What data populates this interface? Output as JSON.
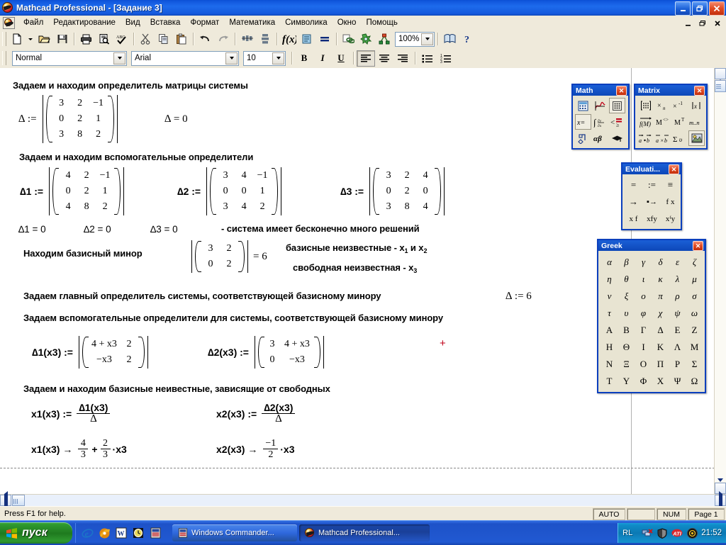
{
  "window": {
    "title": "Mathcad Professional - [Задание  3]",
    "app_icon": "mathcad-logo-icon",
    "buttons": {
      "minimize": "–",
      "restore": "❐",
      "close": "✕"
    }
  },
  "menu": {
    "items": [
      {
        "label": "Файл",
        "name": "menu-file"
      },
      {
        "label": "Редактирование",
        "name": "menu-edit"
      },
      {
        "label": "Вид",
        "name": "menu-view"
      },
      {
        "label": "Вставка",
        "name": "menu-insert"
      },
      {
        "label": "Формат",
        "name": "menu-format"
      },
      {
        "label": "Математика",
        "name": "menu-math"
      },
      {
        "label": "Символика",
        "name": "menu-symbolics"
      },
      {
        "label": "Окно",
        "name": "menu-window"
      },
      {
        "label": "Помощь",
        "name": "menu-help"
      }
    ],
    "mdi_buttons": {
      "minimize": "–",
      "restore": "❐",
      "close": "✕"
    }
  },
  "standard_toolbar": {
    "buttons": [
      {
        "name": "new-document-icon",
        "tip": "New"
      },
      {
        "name": "new-dropdown-icon",
        "tip": "New dropdown"
      },
      {
        "name": "open-folder-icon",
        "tip": "Open"
      },
      {
        "name": "save-icon",
        "tip": "Save"
      },
      {
        "name": "print-icon",
        "tip": "Print"
      },
      {
        "name": "print-preview-icon",
        "tip": "Print Preview"
      },
      {
        "name": "spellcheck-icon",
        "tip": "Check Spelling"
      },
      {
        "name": "cut-scissors-icon",
        "tip": "Cut"
      },
      {
        "name": "copy-icon",
        "tip": "Copy"
      },
      {
        "name": "paste-icon",
        "tip": "Paste"
      },
      {
        "name": "undo-icon",
        "tip": "Undo"
      },
      {
        "name": "redo-icon",
        "tip": "Redo"
      },
      {
        "name": "align-across-icon",
        "tip": "Align Across"
      },
      {
        "name": "align-down-icon",
        "tip": "Align Down"
      },
      {
        "name": "insert-function-icon",
        "tip": "Insert Function"
      },
      {
        "name": "insert-unit-icon",
        "tip": "Insert Unit"
      },
      {
        "name": "calculate-icon",
        "tip": "Calculate"
      },
      {
        "name": "insert-hyperlink-icon",
        "tip": "Insert Hyperlink"
      },
      {
        "name": "component-wizard-icon",
        "tip": "Component Wizard"
      },
      {
        "name": "resource-center-icon",
        "tip": "Resource Center"
      },
      {
        "name": "help-book-icon",
        "tip": "Help Topics"
      },
      {
        "name": "help-question-icon",
        "tip": "Context Help"
      }
    ],
    "zoom": {
      "value": "100%",
      "name": "zoom-combo"
    }
  },
  "format_toolbar": {
    "style": {
      "value": "Normal",
      "name": "paragraph-style-combo"
    },
    "font": {
      "value": "Arial",
      "name": "font-name-combo"
    },
    "size": {
      "value": "10",
      "name": "font-size-combo"
    },
    "bold": "B",
    "italic": "I",
    "underline": "U",
    "align_left": "align-left-icon",
    "align_center": "align-center-icon",
    "align_right": "align-right-icon",
    "bullet_list": "bullet-list-icon",
    "number_list": "numbered-list-icon"
  },
  "document": {
    "regions": [
      {
        "id": "h1",
        "kind": "text",
        "text": "Задаем и находим определитель матрицы системы"
      },
      {
        "id": "d1",
        "kind": "matrix-def",
        "label": "∆ :=",
        "matrix": [
          [
            "3",
            "2",
            "−1"
          ],
          [
            "0",
            "2",
            "1"
          ],
          [
            "3",
            "8",
            "2"
          ]
        ]
      },
      {
        "id": "d1res",
        "kind": "eval",
        "text": "∆ = 0"
      },
      {
        "id": "h2",
        "kind": "text",
        "text": "Задаем и находим вспомогательные определители"
      },
      {
        "id": "d2",
        "kind": "matrix-def",
        "label": "∆1 :=",
        "matrix": [
          [
            "4",
            "2",
            "−1"
          ],
          [
            "0",
            "2",
            "1"
          ],
          [
            "4",
            "8",
            "2"
          ]
        ]
      },
      {
        "id": "d3",
        "kind": "matrix-def",
        "label": "∆2 :=",
        "matrix": [
          [
            "3",
            "4",
            "−1"
          ],
          [
            "0",
            "0",
            "1"
          ],
          [
            "3",
            "4",
            "2"
          ]
        ]
      },
      {
        "id": "d4",
        "kind": "matrix-def",
        "label": "∆3 :=",
        "matrix": [
          [
            "3",
            "2",
            "4"
          ],
          [
            "0",
            "2",
            "0"
          ],
          [
            "3",
            "8",
            "4"
          ]
        ]
      },
      {
        "id": "r1",
        "kind": "eval",
        "text": "∆1 = 0"
      },
      {
        "id": "r2",
        "kind": "eval",
        "text": "∆2 = 0"
      },
      {
        "id": "r3",
        "kind": "eval",
        "text": "∆3 = 0"
      },
      {
        "id": "note1",
        "kind": "text",
        "text": "- система имеет бесконечно много решений"
      },
      {
        "id": "h3",
        "kind": "text",
        "text": "Находим базисный минор"
      },
      {
        "id": "minor",
        "kind": "matrix-eval",
        "matrix": [
          [
            "3",
            "2"
          ],
          [
            "0",
            "2"
          ]
        ],
        "result": "= 6"
      },
      {
        "id": "note2",
        "kind": "text",
        "text": "базисные неизвестные - x1 и x2"
      },
      {
        "id": "note3",
        "kind": "text",
        "text": "свободная неизвестная - x3"
      },
      {
        "id": "h4",
        "kind": "text",
        "text": "Задаем главный определитель системы, соответствующей базисному минору"
      },
      {
        "id": "delta6",
        "kind": "eval",
        "text": "∆ := 6"
      },
      {
        "id": "h5",
        "kind": "text",
        "text": "Задаем вспомогательные определители для системы, соответствующей базисному минору"
      },
      {
        "id": "dx1",
        "kind": "matrix-def",
        "label": "∆1(x3) :=",
        "matrix": [
          [
            "4 + x3",
            "2"
          ],
          [
            "−x3",
            "2"
          ]
        ]
      },
      {
        "id": "dx2",
        "kind": "matrix-def",
        "label": "∆2(x3) :=",
        "matrix": [
          [
            "3",
            "4 + x3"
          ],
          [
            "0",
            "−x3"
          ]
        ]
      },
      {
        "id": "h6",
        "kind": "text",
        "text": "Задаем и находим базисные неивестные, зависящие от свободных"
      },
      {
        "id": "x1def",
        "kind": "fraction-def",
        "label": "x1(x3) :=",
        "num": "∆1(x3)",
        "den": "∆"
      },
      {
        "id": "x2def",
        "kind": "fraction-def",
        "label": "x2(x3) :=",
        "num": "∆2(x3)",
        "den": "∆"
      },
      {
        "id": "x1res",
        "kind": "symbolic",
        "label": "x1(x3) →",
        "terms": [
          {
            "num": "4",
            "den": "3"
          },
          {
            "op": "+"
          },
          {
            "num": "2",
            "den": "3",
            "mul": "·x3"
          }
        ]
      },
      {
        "id": "x2res",
        "kind": "symbolic",
        "label": "x2(x3) →",
        "terms": [
          {
            "num": "−1",
            "den": "2",
            "mul": "·x3"
          }
        ]
      }
    ],
    "labels": {
      "h1": "Задаем и находим определитель матрицы системы",
      "h2": "Задаем и находим вспомогательные определители",
      "h3": "Находим базисный минор",
      "h4": "Задаем главный определитель системы, соответствующей базисному минору",
      "h5": "Задаем вспомогательные определители для системы, соответствующей базисному минору",
      "h6": "Задаем и находим базисные неивестные, зависящие от свободных",
      "note1": "- система имеет бесконечно много решений",
      "note2_pre": "базисные неизвестные - x",
      "note2_a": "1",
      "note2_mid": " и x",
      "note2_b": "2",
      "note3_pre": "свободная неизвестная - x",
      "note3_a": "3",
      "d1_label": "∆ :=",
      "d1_result": "∆ = 0",
      "d2_label": "∆1 :=",
      "d3_label": "∆2 :=",
      "d4_label": "∆3 :=",
      "r1": "∆1 = 0",
      "r2": "∆2 = 0",
      "r3": "∆3 = 0",
      "minor_result": "= 6",
      "delta6": "∆ := 6",
      "dx1_label": "∆1(x3) :=",
      "dx2_label": "∆2(x3) :=",
      "x1_label": "x1(x3) :=",
      "x2_label": "x2(x3) :=",
      "x1_num": "∆1(x3)",
      "x2_num": "∆2(x3)",
      "den_delta": "∆",
      "x1_arrow": "x1(x3) →",
      "x2_arrow": "x2(x3) →",
      "f43_n": "4",
      "f43_d": "3",
      "plus": "+",
      "f23_n": "2",
      "f23_d": "3",
      "f23_mul": "·x3",
      "fm12_n": "−1",
      "fm12_d": "2",
      "fm12_mul": "·x3"
    },
    "cursor": "+"
  },
  "palettes": {
    "math": {
      "title": "Math",
      "close": "✕",
      "buttons": [
        {
          "name": "calculator-palette-icon",
          "glyph": "calc"
        },
        {
          "name": "graph-palette-icon",
          "glyph": "graph"
        },
        {
          "name": "matrix-palette-icon",
          "glyph": "matrix"
        },
        {
          "name": "evaluation-palette-icon",
          "glyph": "x="
        },
        {
          "name": "calculus-palette-icon",
          "glyph": "∫"
        },
        {
          "name": "boolean-palette-icon",
          "glyph": "<"
        },
        {
          "name": "programming-palette-icon",
          "glyph": "prog"
        },
        {
          "name": "greek-palette-icon",
          "glyph": "αβ"
        },
        {
          "name": "symbolic-palette-icon",
          "glyph": "cap"
        }
      ]
    },
    "matrix": {
      "title": "Matrix",
      "close": "✕",
      "buttons": [
        {
          "name": "insert-matrix-icon",
          "glyph": "[:::]"
        },
        {
          "name": "matrix-subscript-icon",
          "glyph": "×n"
        },
        {
          "name": "matrix-inverse-icon",
          "glyph": "x⁻¹"
        },
        {
          "name": "determinant-icon",
          "glyph": "|x|"
        },
        {
          "name": "vectorize-icon",
          "glyph": "f(M)"
        },
        {
          "name": "matrix-column-icon",
          "glyph": "M<>"
        },
        {
          "name": "matrix-transpose-icon",
          "glyph": "Mᵀ"
        },
        {
          "name": "range-variable-icon",
          "glyph": "m..n"
        },
        {
          "name": "dot-product-icon",
          "glyph": "a·b"
        },
        {
          "name": "cross-product-icon",
          "glyph": "a×b"
        },
        {
          "name": "vector-sum-icon",
          "glyph": "Σv"
        },
        {
          "name": "picture-icon",
          "glyph": "pic"
        }
      ]
    },
    "evaluation": {
      "title": "Evaluati...",
      "close": "✕",
      "buttons": [
        {
          "name": "equal-icon",
          "glyph": "="
        },
        {
          "name": "define-icon",
          "glyph": ":="
        },
        {
          "name": "global-define-icon",
          "glyph": "≡"
        },
        {
          "name": "symbolic-eval-icon",
          "glyph": "→"
        },
        {
          "name": "symbolic-keyword-eval-icon",
          "glyph": "▪→"
        },
        {
          "name": "function-icon",
          "glyph": "f x"
        },
        {
          "name": "prefix-operator-icon",
          "glyph": "x f"
        },
        {
          "name": "infix-operator-icon",
          "glyph": "xfy"
        },
        {
          "name": "treeform-operator-icon",
          "glyph": "xᶠy"
        }
      ]
    },
    "greek": {
      "title": "Greek",
      "close": "✕",
      "rows": [
        [
          "α",
          "β",
          "γ",
          "δ",
          "ε",
          "ζ"
        ],
        [
          "η",
          "θ",
          "ι",
          "κ",
          "λ",
          "μ"
        ],
        [
          "ν",
          "ξ",
          "ο",
          "π",
          "ρ",
          "σ"
        ],
        [
          "τ",
          "υ",
          "φ",
          "χ",
          "ψ",
          "ω"
        ],
        [
          "A",
          "B",
          "Γ",
          "Δ",
          "E",
          "Z"
        ],
        [
          "H",
          "Θ",
          "I",
          "K",
          "Λ",
          "M"
        ],
        [
          "N",
          "Ξ",
          "O",
          "Π",
          "P",
          "Σ"
        ],
        [
          "T",
          "Y",
          "Φ",
          "X",
          "Ψ",
          "Ω"
        ]
      ]
    }
  },
  "statusbar": {
    "message": "Press F1 for help.",
    "fields": [
      "AUTO",
      "",
      "NUM",
      "Page 1"
    ]
  },
  "taskbar": {
    "start": "пуск",
    "quick_launch": [
      {
        "name": "internet-explorer-icon"
      },
      {
        "name": "media-player-icon"
      },
      {
        "name": "word-icon"
      },
      {
        "name": "clock-icon"
      },
      {
        "name": "commander-icon"
      }
    ],
    "tasks": [
      {
        "name": "taskbar-item-windows-commander",
        "label": "Windows Commander...",
        "icon": "commander-icon",
        "active": false
      },
      {
        "name": "taskbar-item-mathcad",
        "label": "Mathcad Professional...",
        "icon": "mathcad-logo-icon",
        "active": true
      }
    ],
    "keyboard_layout": "RL",
    "tray": [
      {
        "name": "network-disconnected-icon"
      },
      {
        "name": "shield-icon"
      },
      {
        "name": "ati-icon"
      },
      {
        "name": "volume-icon"
      }
    ],
    "clock": "21:52"
  }
}
